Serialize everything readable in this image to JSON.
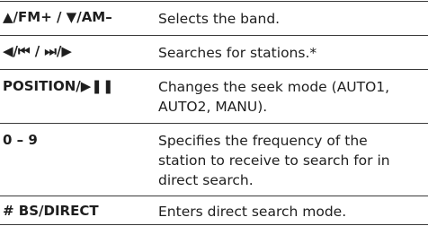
{
  "rows": [
    {
      "key": "▲/FM+ / ▼/AM–",
      "desc_lines": [
        "Selects the band."
      ]
    },
    {
      "key": "◀/⏮ / ⏭/▶",
      "desc_lines": [
        "Searches for stations.*"
      ]
    },
    {
      "key": "POSITION/▶❚❚",
      "desc_lines": [
        "Changes the seek mode (AUTO1,",
        "AUTO2, MANU)."
      ]
    },
    {
      "key": "0 – 9",
      "desc_lines": [
        "Specifies the frequency of the",
        "station to receive to search for in",
        "direct search."
      ]
    },
    {
      "key": "# BS/DIRECT",
      "desc_lines": [
        "Enters direct search mode."
      ]
    }
  ]
}
